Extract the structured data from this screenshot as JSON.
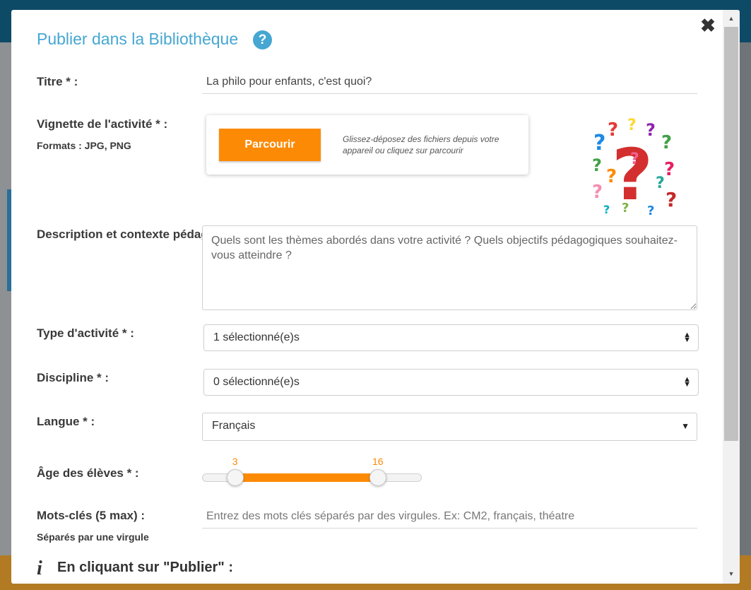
{
  "modal": {
    "title": "Publier dans la Bibliothèque",
    "help_glyph": "?",
    "close_glyph": "✖"
  },
  "form": {
    "titre": {
      "label": "Titre * :",
      "value": "La philo pour enfants, c'est quoi?"
    },
    "vignette": {
      "label": "Vignette de l'activité * :",
      "formats": "Formats : JPG, PNG",
      "browse_label": "Parcourir",
      "drop_hint": "Glissez-déposez des fichiers depuis votre appareil ou cliquez sur parcourir"
    },
    "description": {
      "label": "Description et contexte pédagogique * :",
      "placeholder": "Quels sont les thèmes abordés dans votre activité ? Quels objectifs pédagogiques souhaitez-vous atteindre ?"
    },
    "type_activite": {
      "label": "Type d'activité * :",
      "value": "1 sélectionné(e)s"
    },
    "discipline": {
      "label": "Discipline * :",
      "value": "0 sélectionné(e)s"
    },
    "langue": {
      "label": "Langue * :",
      "value": "Français"
    },
    "age": {
      "label": "Âge des élèves * :",
      "min_value": 3,
      "max_value": 16,
      "min_label": "3",
      "max_label": "16"
    },
    "mots_cles": {
      "label": "Mots-clés (5 max) :",
      "sublabel": "Séparés par une virgule",
      "placeholder": "Entrez des mots clés séparés par des virgules. Ex: CM2, français, théatre"
    },
    "publish_info": {
      "icon_glyph": "i",
      "title": "En cliquant sur \"Publier\" :"
    }
  },
  "colors": {
    "accent": "#45a7d2",
    "orange": "#fd8a05"
  }
}
